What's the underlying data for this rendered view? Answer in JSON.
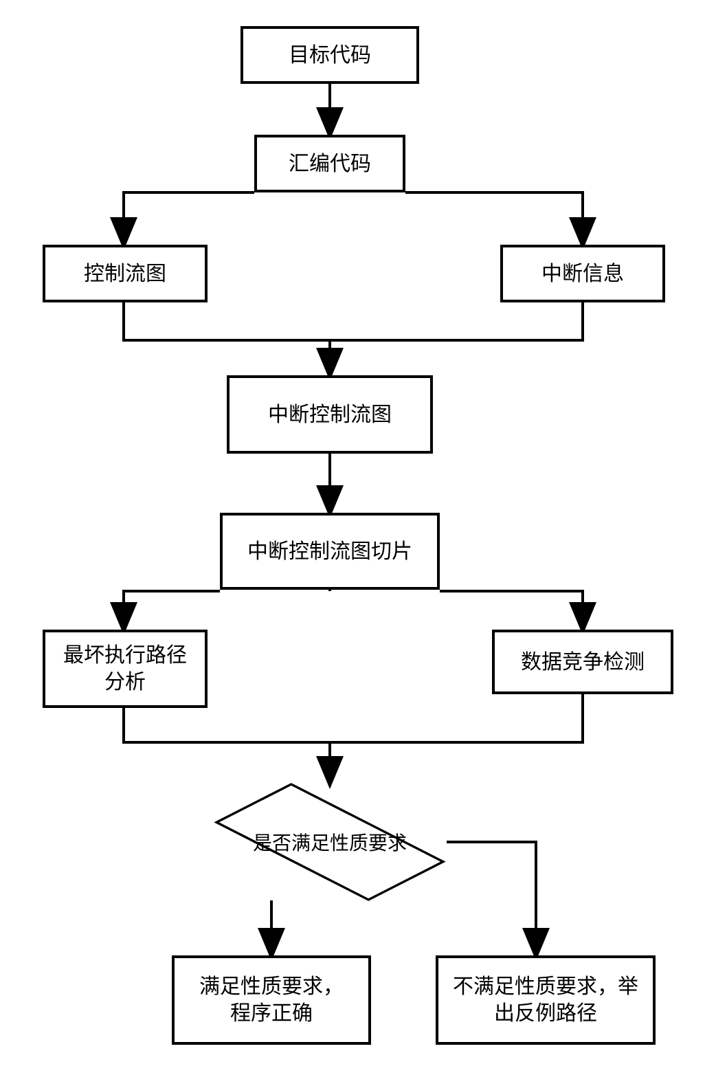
{
  "chart_data": {
    "type": "flowchart",
    "nodes": [
      {
        "id": "n1",
        "label": "目标代码",
        "shape": "rect"
      },
      {
        "id": "n2",
        "label": "汇编代码",
        "shape": "rect"
      },
      {
        "id": "n3",
        "label": "控制流图",
        "shape": "rect"
      },
      {
        "id": "n4",
        "label": "中断信息",
        "shape": "rect"
      },
      {
        "id": "n5",
        "label": "中断控制流图",
        "shape": "rect"
      },
      {
        "id": "n6",
        "label": "中断控制流图切片",
        "shape": "rect"
      },
      {
        "id": "n7",
        "label": "最坏执行路径\n分析",
        "shape": "rect"
      },
      {
        "id": "n8",
        "label": "数据竞争检测",
        "shape": "rect"
      },
      {
        "id": "n9",
        "label": "是否满足性质要求",
        "shape": "diamond"
      },
      {
        "id": "n10",
        "label": "满足性质要求，\n程序正确",
        "shape": "rect"
      },
      {
        "id": "n11",
        "label": "不满足性质要求，举\n出反例路径",
        "shape": "rect"
      }
    ],
    "edges": [
      {
        "from": "n1",
        "to": "n2"
      },
      {
        "from": "n2",
        "to": "n3"
      },
      {
        "from": "n2",
        "to": "n4"
      },
      {
        "from": "n3",
        "to": "n5"
      },
      {
        "from": "n4",
        "to": "n5"
      },
      {
        "from": "n5",
        "to": "n6"
      },
      {
        "from": "n6",
        "to": "n7"
      },
      {
        "from": "n6",
        "to": "n8"
      },
      {
        "from": "n7",
        "to": "n9"
      },
      {
        "from": "n8",
        "to": "n9"
      },
      {
        "from": "n9",
        "to": "n10"
      },
      {
        "from": "n9",
        "to": "n11"
      }
    ]
  },
  "nodes": {
    "n1": "目标代码",
    "n2": "汇编代码",
    "n3": "控制流图",
    "n4": "中断信息",
    "n5": "中断控制流图",
    "n6": "中断控制流图切片",
    "n7": "最坏执行路径\n分析",
    "n8": "数据竞争检测",
    "n9": "是否满足性质要求",
    "n10": "满足性质要求，\n程序正确",
    "n11": "不满足性质要求，举\n出反例路径"
  }
}
